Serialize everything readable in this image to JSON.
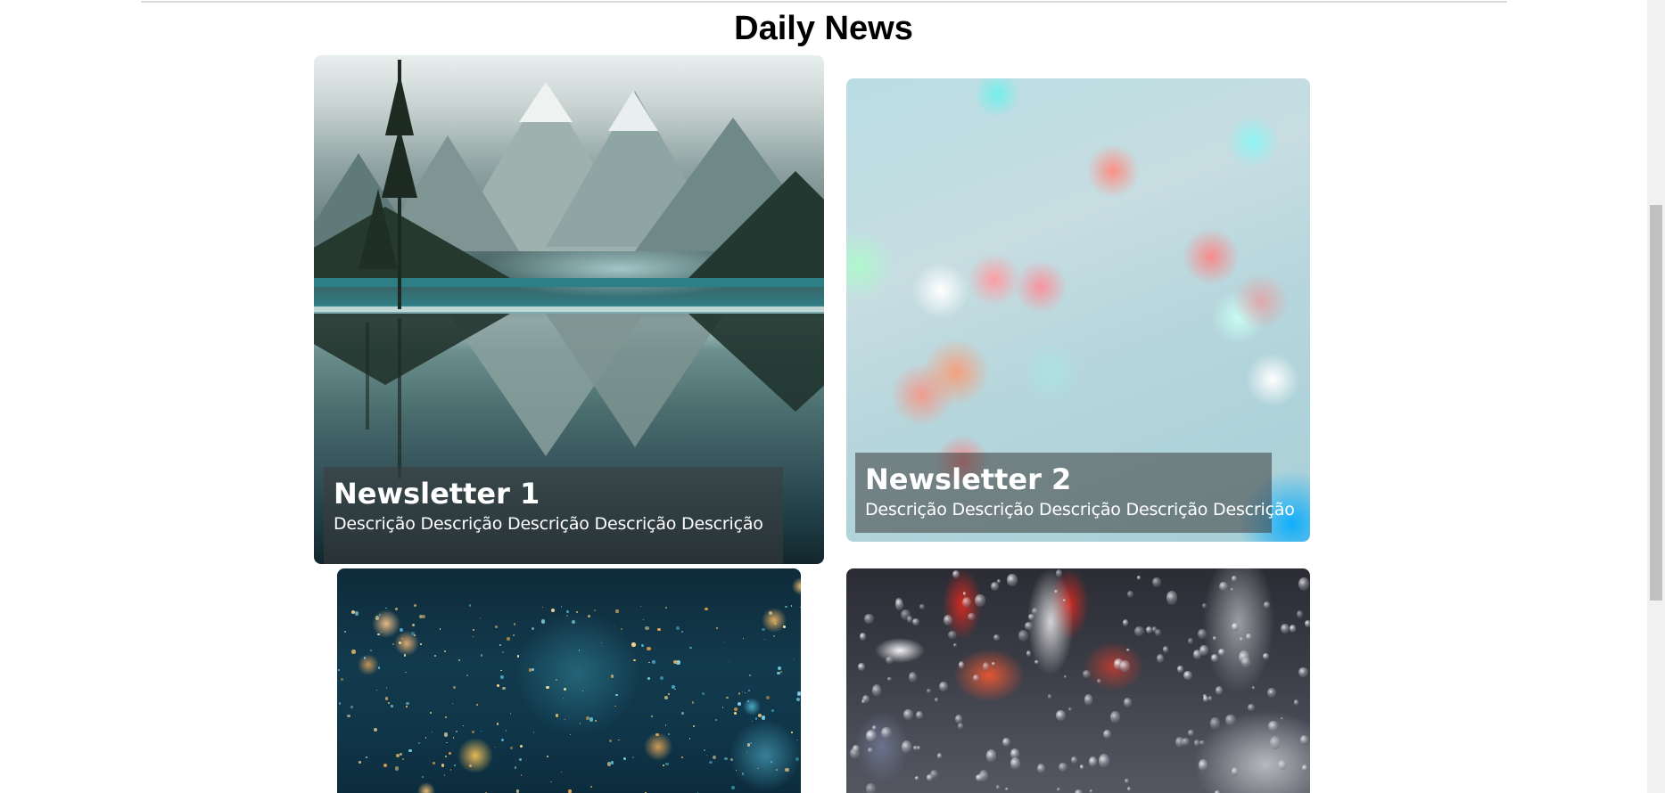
{
  "page": {
    "title": "Daily News"
  },
  "cards": [
    {
      "title": "Newsletter 1",
      "description": "Descrição Descrição Descrição Descrição Descrição",
      "image": "mountain-lake-image"
    },
    {
      "title": "Newsletter 2",
      "description": "Descrição Descrição Descrição Descrição Descrição",
      "image": "bokeh-lights-image"
    },
    {
      "title": "",
      "description": "",
      "image": "glitter-bokeh-image"
    },
    {
      "title": "",
      "description": "",
      "image": "rain-on-glass-image"
    }
  ],
  "colors": {
    "caption_background": "#3c3c3c",
    "caption_text": "#ffffff",
    "title_text": "#000000"
  }
}
